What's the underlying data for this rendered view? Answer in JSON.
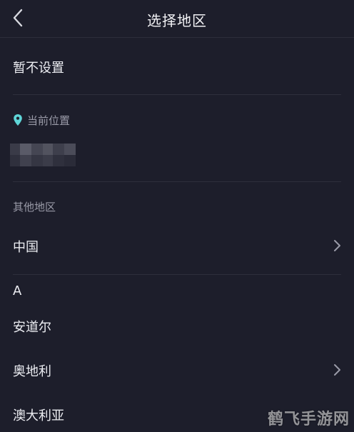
{
  "header": {
    "title": "选择地区",
    "back_icon": "chevron-left-icon"
  },
  "no_setting": {
    "label": "暂不设置"
  },
  "current_location": {
    "section_label": "当前位置",
    "icon": "location-pin-icon",
    "icon_color": "#5fd6d8"
  },
  "other_regions": {
    "section_label": "其他地区",
    "china": {
      "label": "中国",
      "icon": "chevron-right-icon"
    }
  },
  "index_letter": "A",
  "regions": [
    {
      "label": "安道尔",
      "has_children": false
    },
    {
      "label": "奥地利",
      "has_children": true
    },
    {
      "label": "澳大利亚",
      "has_children": false
    }
  ],
  "watermark": "鹤飞手游网",
  "colors": {
    "background": "#1d1e2b",
    "text": "#ecedf2",
    "secondary_text": "#9a9ba8",
    "divider": "#2e2f3c",
    "accent": "#5fd6d8"
  }
}
